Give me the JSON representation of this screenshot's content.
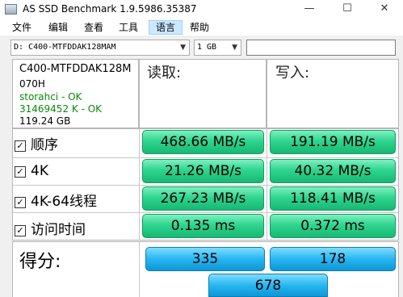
{
  "window": {
    "title": "AS SSD Benchmark 1.9.5986.35387",
    "minimize": "—",
    "maximize": "☐",
    "close": "✕"
  },
  "menu": {
    "items": [
      "文件",
      "编辑",
      "查看",
      "工具",
      "语言",
      "帮助"
    ],
    "active": "语言"
  },
  "toolbar": {
    "drive_select": "D: C400-MTFDDAK128MAM",
    "size_select": "1 GB",
    "result_field": ""
  },
  "drive_info": {
    "model": "C400-MTFDDAK128M",
    "firmware": "070H",
    "driver_status": "storahci - OK",
    "alignment_status": "31469452 K - OK",
    "capacity": "119.24 GB"
  },
  "columns": {
    "read": "读取:",
    "write": "写入:"
  },
  "tests": [
    {
      "label": "顺序",
      "checked": true,
      "read": "468.66 MB/s",
      "write": "191.19 MB/s"
    },
    {
      "label": "4K",
      "checked": true,
      "read": "21.26 MB/s",
      "write": "40.32 MB/s"
    },
    {
      "label": "4K-64线程",
      "checked": true,
      "read": "267.23 MB/s",
      "write": "118.41 MB/s"
    },
    {
      "label": "访问时间",
      "checked": true,
      "read": "0.135 ms",
      "write": "0.372 ms"
    }
  ],
  "score": {
    "label": "得分:",
    "read": "335",
    "write": "178",
    "total": "678"
  },
  "colors": {
    "result_green": "#2fd58f",
    "score_blue": "#27b6f0",
    "status_ok": "#0a8a0a"
  }
}
